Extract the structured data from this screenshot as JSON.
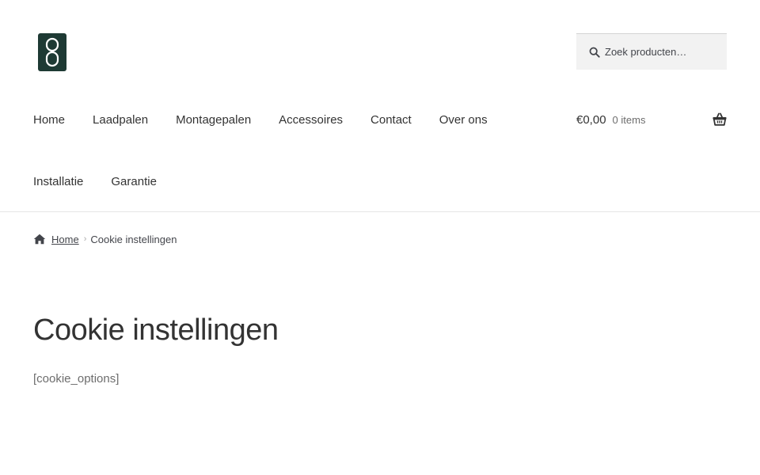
{
  "header": {
    "search": {
      "placeholder": "Zoek producten…"
    },
    "nav": {
      "row1": [
        "Home",
        "Laadpalen",
        "Montagepalen",
        "Accessoires",
        "Contact",
        "Over ons"
      ],
      "row2": [
        "Installatie",
        "Garantie"
      ]
    },
    "cart": {
      "amount": "€0,00",
      "count": "0 items"
    }
  },
  "breadcrumb": {
    "home": "Home",
    "separator": "›",
    "current": "Cookie instellingen"
  },
  "main": {
    "title": "Cookie instellingen",
    "content": "[cookie_options]"
  },
  "colors": {
    "logo": "#1e3a34",
    "search_bg": "#f2f2f2",
    "divider": "#e6e6e6"
  }
}
